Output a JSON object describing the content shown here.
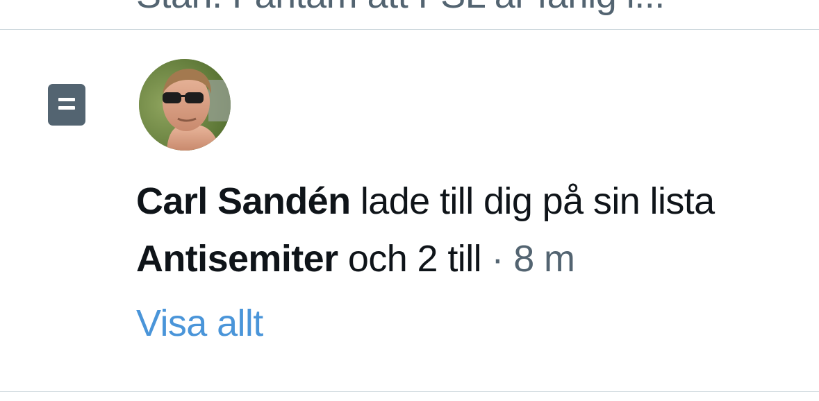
{
  "previous_notification": {
    "snippet": "Stan. Fantam att FSL är farlig i..."
  },
  "notification": {
    "icon": "list-icon",
    "actor_name": "Carl Sandén",
    "action_text": " lade till dig på sin lista ",
    "list_name": "Antisemiter",
    "others_text": " och 2 till",
    "separator": " · ",
    "time_ago": "8 m",
    "show_all_label": "Visa allt"
  },
  "colors": {
    "text_primary": "#0f1419",
    "text_secondary": "#536471",
    "link": "#4a95d9",
    "divider": "#cfd9de"
  }
}
